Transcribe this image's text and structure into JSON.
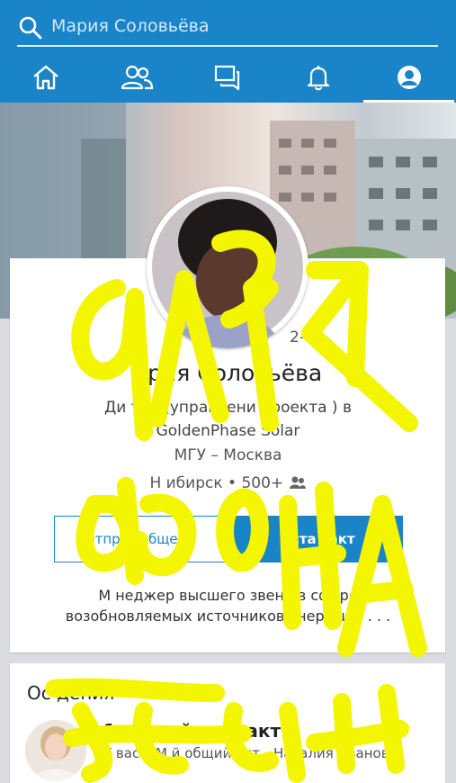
{
  "search": {
    "query": "Мария Соловьёва",
    "icon": "search-icon"
  },
  "nav": {
    "items": [
      {
        "name": "home",
        "icon": "home-icon"
      },
      {
        "name": "network",
        "icon": "people-icon"
      },
      {
        "name": "messages",
        "icon": "chat-icon"
      },
      {
        "name": "notifications",
        "icon": "bell-icon"
      },
      {
        "name": "profile",
        "icon": "profile-icon",
        "active": true
      }
    ]
  },
  "profile": {
    "degree": "2-",
    "name": "ария Соловьёва",
    "headline": "Ди     тор (управлени  проекта  ) в GoldenPhase Solar",
    "education": "МГУ – Москва",
    "location": "Н     ибирск • 500+",
    "message_button": "Отпр   сообщени",
    "connect_button": "Уста          такт",
    "summary": "М  неджер высшего звена в  сфере возобновляемых источников энергии с . . ."
  },
  "highlights": {
    "title": "Ос              дения",
    "contact_title": "1 общий контакт",
    "contact_desc": "У вас с М      й общий      акт - Наталия Иванова"
  },
  "overlay": {
    "handwriting": "ДЛЯ ФОНА"
  },
  "colors": {
    "brand": "#1a84c8",
    "scribble": "#f4f500"
  }
}
